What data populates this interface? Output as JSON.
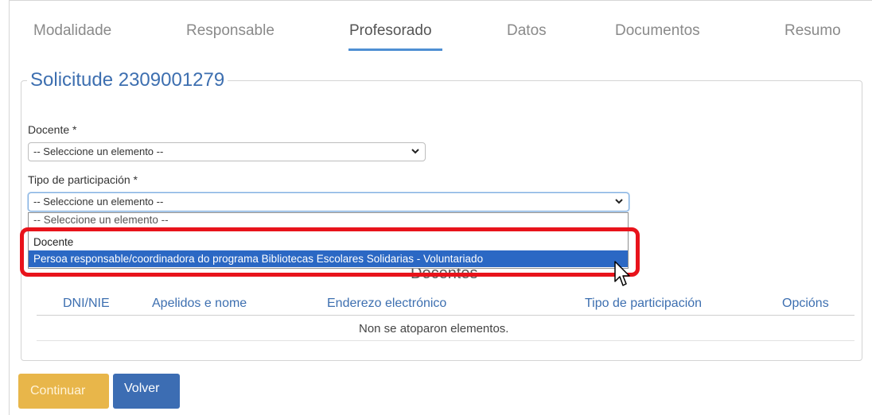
{
  "tabs": [
    {
      "label": "Modalidade"
    },
    {
      "label": "Responsable"
    },
    {
      "label": "Profesorado"
    },
    {
      "label": "Datos"
    },
    {
      "label": "Documentos"
    },
    {
      "label": "Resumo"
    }
  ],
  "active_tab": "Profesorado",
  "form": {
    "legend": "Solicitude 2309001279",
    "docente_label": "Docente *",
    "docente_value": "-- Seleccione un elemento --",
    "tipo_label": "Tipo de participación *",
    "tipo_value": "-- Seleccione un elemento --"
  },
  "dropdown": {
    "options": [
      "-- Seleccione un elemento --",
      "Docente",
      "Persoa responsable/coordinadora do programa Bibliotecas Escolares Solidarias - Voluntariado"
    ],
    "highlighted_index": 2
  },
  "table": {
    "title": "Docentes",
    "headers": [
      "DNI/NIE",
      "Apelidos e nome",
      "Enderezo electrónico",
      "Tipo de participación",
      "Opcións"
    ],
    "empty_text": "Non se atoparon elementos."
  },
  "buttons": {
    "continue": "Continuar",
    "back": "Volver"
  },
  "colors": {
    "accent": "#3d6fb0",
    "continue_button": "#e8b64a",
    "back_button": "#3c6db3",
    "highlight_option": "#2b68c4",
    "annotation_box": "#e8131b"
  }
}
